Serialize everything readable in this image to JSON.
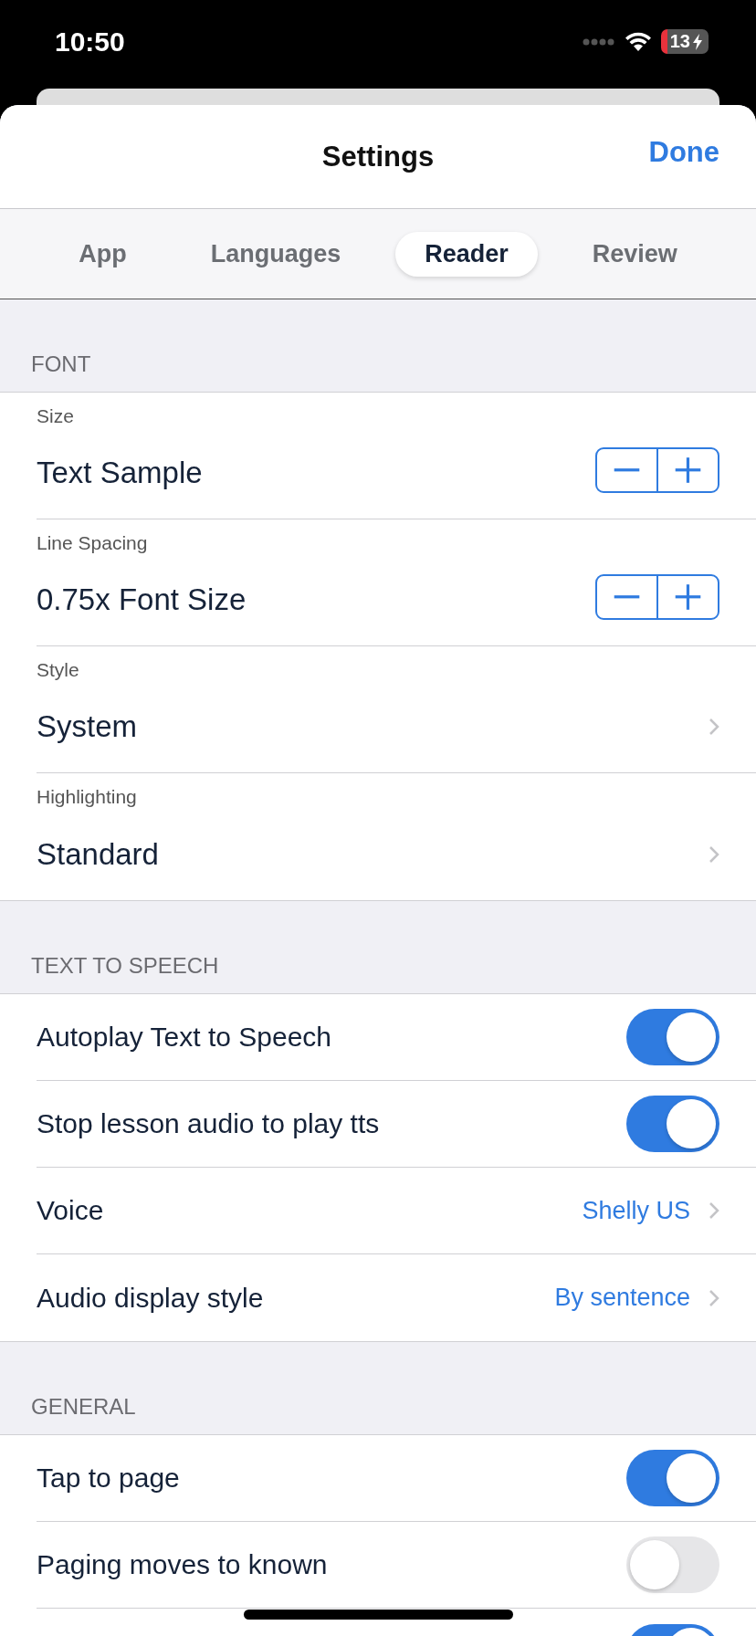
{
  "status_bar": {
    "time": "10:50",
    "battery": "13"
  },
  "header": {
    "title": "Settings",
    "done": "Done"
  },
  "tabs": [
    {
      "label": "App",
      "selected": false
    },
    {
      "label": "Languages",
      "selected": false
    },
    {
      "label": "Reader",
      "selected": true
    },
    {
      "label": "Review",
      "selected": false
    }
  ],
  "sections": [
    {
      "title": "FONT",
      "rows": [
        {
          "kind": "stepper",
          "label": "Size",
          "value": "Text Sample"
        },
        {
          "kind": "stepper",
          "label": "Line Spacing",
          "value": "0.75x Font Size"
        },
        {
          "kind": "picker",
          "label": "Style",
          "value": "System"
        },
        {
          "kind": "picker",
          "label": "Highlighting",
          "value": "Standard"
        }
      ]
    },
    {
      "title": "TEXT TO SPEECH",
      "rows": [
        {
          "kind": "toggle",
          "label": "Autoplay Text to Speech",
          "on": true
        },
        {
          "kind": "toggle",
          "label": "Stop lesson audio to play tts",
          "on": true
        },
        {
          "kind": "detail",
          "label": "Voice",
          "value": "Shelly US"
        },
        {
          "kind": "detail",
          "label": "Audio display style",
          "value": "By sentence"
        }
      ]
    },
    {
      "title": "GENERAL",
      "rows": [
        {
          "kind": "toggle",
          "label": "Tap to page",
          "on": true
        },
        {
          "kind": "toggle",
          "label": "Paging moves to known",
          "on": false
        },
        {
          "kind": "toggle",
          "on": true
        }
      ]
    }
  ]
}
